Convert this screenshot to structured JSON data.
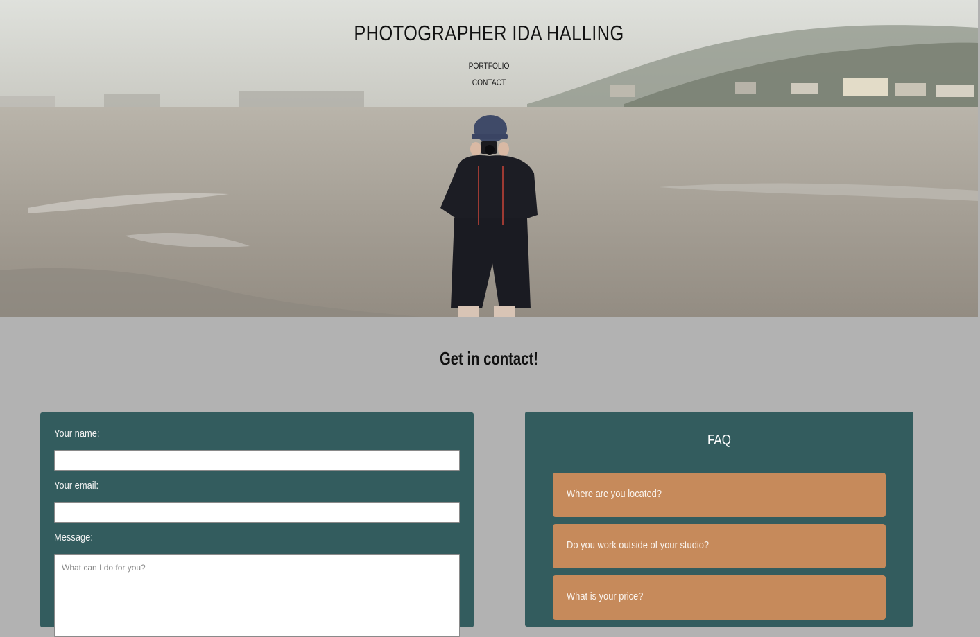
{
  "header": {
    "site_title": "PHOTOGRAPHER IDA HALLING",
    "nav": [
      {
        "label": "PORTFOLIO"
      },
      {
        "label": "CONTACT"
      }
    ]
  },
  "contact": {
    "heading": "Get in contact!",
    "form": {
      "name_label": "Your name:",
      "name_value": "",
      "email_label": "Your email:",
      "email_value": "",
      "message_label": "Message:",
      "message_placeholder": "What can I do for you?"
    }
  },
  "faq": {
    "title": "FAQ",
    "items": [
      {
        "question": "Where are you located?"
      },
      {
        "question": "Do you work outside of your studio?"
      },
      {
        "question": "What is your price?"
      }
    ]
  },
  "colors": {
    "page_background": "#b2b2b2",
    "card_background": "#335c5e",
    "faq_item_background": "#c68a5b"
  }
}
